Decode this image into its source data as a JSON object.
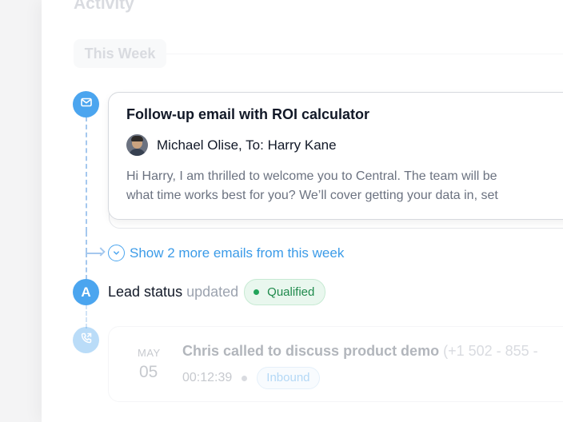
{
  "activity": {
    "title": "Activity"
  },
  "week_label": "This Week",
  "email": {
    "title": "Follow-up email with ROI calculator",
    "from_line": "Michael Olise, To: Harry Kane",
    "preview_line1": "Hi Harry, I am thrilled to welcome you to Central. The team will be",
    "preview_line2": "what time works best for you? We’ll cover getting your data in, set"
  },
  "show_more": {
    "label": "Show 2 more emails from this week"
  },
  "lead": {
    "avatar_letter": "A",
    "label": "Lead status",
    "action": "updated",
    "status": "Qualified"
  },
  "call": {
    "month": "MAY",
    "day": "05",
    "title": "Chris called to discuss product demo",
    "number": "(+1 502 - 855 -",
    "duration": "00:12:39",
    "direction": "Inbound"
  },
  "colors": {
    "accent": "#4ba5ef",
    "link": "#3b9be8",
    "qualified": "#22a45a"
  },
  "icons": [
    "mail-icon",
    "chevron-down-icon",
    "phone-icon"
  ]
}
